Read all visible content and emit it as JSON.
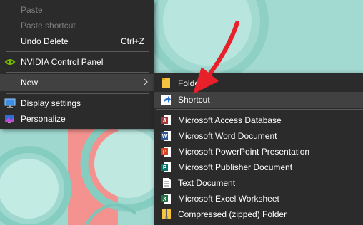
{
  "main_menu": {
    "items": [
      {
        "label": "Paste",
        "disabled": true
      },
      {
        "label": "Paste shortcut",
        "disabled": true
      },
      {
        "label": "Undo Delete",
        "accel": "Ctrl+Z"
      },
      {
        "label": "NVIDIA Control Panel",
        "icon": "nvidia-icon"
      },
      {
        "label": "New",
        "has_submenu": true
      },
      {
        "label": "Display settings",
        "icon": "display-icon"
      },
      {
        "label": "Personalize",
        "icon": "personalize-icon"
      }
    ]
  },
  "sub_menu": {
    "items": [
      {
        "label": "Folder",
        "icon": "folder-icon"
      },
      {
        "label": "Shortcut",
        "icon": "shortcut-icon"
      },
      {
        "label": "Microsoft Access Database",
        "icon": "access-icon",
        "color": "#a4373a"
      },
      {
        "label": "Microsoft Word Document",
        "icon": "word-icon",
        "color": "#2b579a"
      },
      {
        "label": "Microsoft PowerPoint Presentation",
        "icon": "powerpoint-icon",
        "color": "#d24726"
      },
      {
        "label": "Microsoft Publisher Document",
        "icon": "publisher-icon",
        "color": "#077568"
      },
      {
        "label": "Text Document",
        "icon": "text-document-icon"
      },
      {
        "label": "Microsoft Excel Worksheet",
        "icon": "excel-icon",
        "color": "#217346"
      },
      {
        "label": "Compressed (zipped) Folder",
        "icon": "zip-folder-icon"
      }
    ]
  },
  "colors": {
    "menu_bg": "#2b2b2b",
    "hover_bg": "#414141",
    "arrow": "#e8202a",
    "wallpaper_mint": "#9fd8cf",
    "wallpaper_pink": "#f08c8c"
  }
}
